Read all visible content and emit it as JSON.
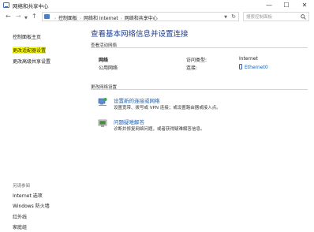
{
  "window": {
    "title": "网络和共享中心",
    "minimize": "—",
    "maximize": "☐",
    "close": "✕"
  },
  "nav": {
    "back": "←",
    "forward": "→",
    "dropdown": "▼",
    "up": "↑",
    "breadcrumbs": [
      "控制面板",
      "网络和 Internet",
      "网络和共享中心"
    ],
    "breadcrumb_sep": "›",
    "address_dropdown": "▼",
    "refresh": "↻",
    "search_placeholder": "搜索控制面板"
  },
  "sidebar": {
    "links": [
      "控制面板主页",
      "更改适配器设置",
      "更改高级共享设置"
    ],
    "see_also_label": "另请参阅",
    "see_also": [
      "Internet 选项",
      "Windows 防火墙",
      "红外线",
      "家庭组"
    ]
  },
  "main": {
    "title": "查看基本网络信息并设置连接",
    "active_networks_label": "查看活动网络",
    "network": {
      "name": "网络",
      "type": "公用网络",
      "access_type_label": "访问类型:",
      "access_type_value": "Internet",
      "connections_label": "连接:",
      "connections_value": "Ethernet0"
    },
    "change_settings_label": "更改网络设置",
    "tasks": [
      {
        "link": "设置新的连接或网络",
        "description": "设置宽带、拨号或 VPN 连接；或设置路由器或接入点。",
        "icon": "new-connection-icon"
      },
      {
        "link": "问题疑难解答",
        "description": "诊断并修复网络问题，或者获得疑难解答信息。",
        "icon": "troubleshoot-icon"
      }
    ]
  },
  "colors": {
    "title_blue": "#1e3e8a",
    "link_blue": "#1a5fb4",
    "highlight": "#ffff00"
  }
}
